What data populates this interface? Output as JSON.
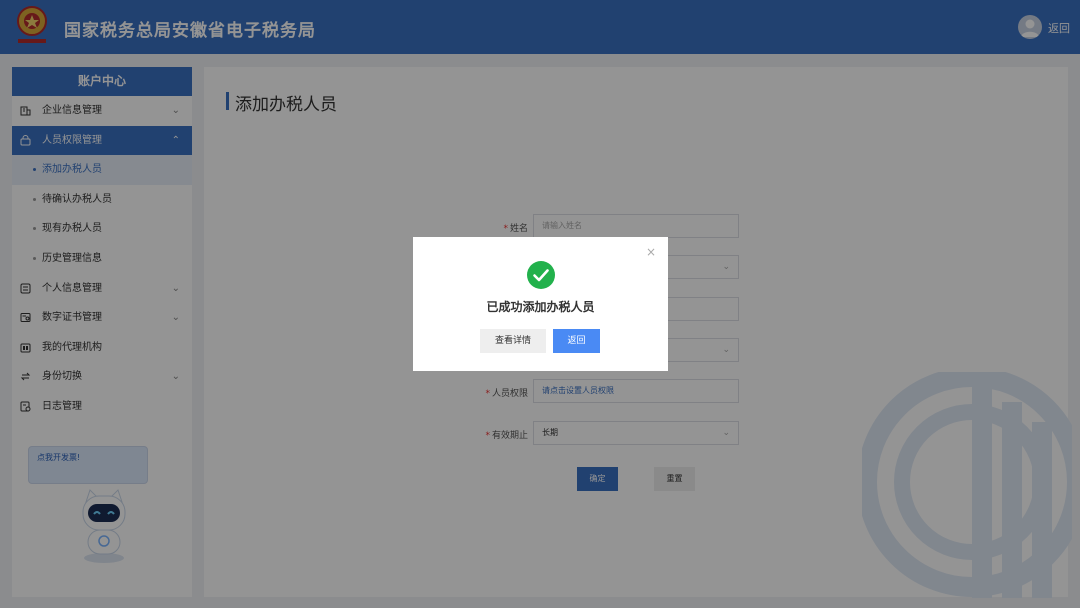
{
  "header": {
    "title": "国家税务总局安徽省电子税务局",
    "back_label": "返回"
  },
  "sidebar": {
    "title": "账户中心",
    "items": [
      {
        "label": "企业信息管理",
        "icon": "building-icon",
        "chevron": "down"
      },
      {
        "label": "人员权限管理",
        "icon": "user-lock-icon",
        "chevron": "up"
      },
      {
        "label": "个人信息管理",
        "icon": "profile-icon",
        "chevron": "down"
      },
      {
        "label": "数字证书管理",
        "icon": "certificate-icon",
        "chevron": "down"
      },
      {
        "label": "我的代理机构",
        "icon": "agency-icon"
      },
      {
        "label": "身份切换",
        "icon": "switch-icon",
        "chevron": "down"
      },
      {
        "label": "日志管理",
        "icon": "log-icon"
      }
    ],
    "subitems": [
      {
        "label": "添加办税人员",
        "selected": true
      },
      {
        "label": "待确认办税人员"
      },
      {
        "label": "现有办税人员"
      },
      {
        "label": "历史管理信息"
      }
    ]
  },
  "assistant": {
    "bubble_text": "点我开发票!"
  },
  "main": {
    "page_title": "添加办税人员",
    "form": {
      "name_label": "姓名",
      "name_placeholder": "请输入姓名",
      "permission_label": "人员权限",
      "permission_value": "请点击设置人员权限",
      "validity_label": "有效期止",
      "validity_value": "长期",
      "confirm_label": "确定",
      "reset_label": "重置"
    }
  },
  "modal": {
    "message": "已成功添加办税人员",
    "detail_button": "查看详情",
    "back_button": "返回"
  },
  "colors": {
    "brand": "#3a70c2",
    "success": "#22b14c",
    "primary_button": "#4a8af4"
  }
}
